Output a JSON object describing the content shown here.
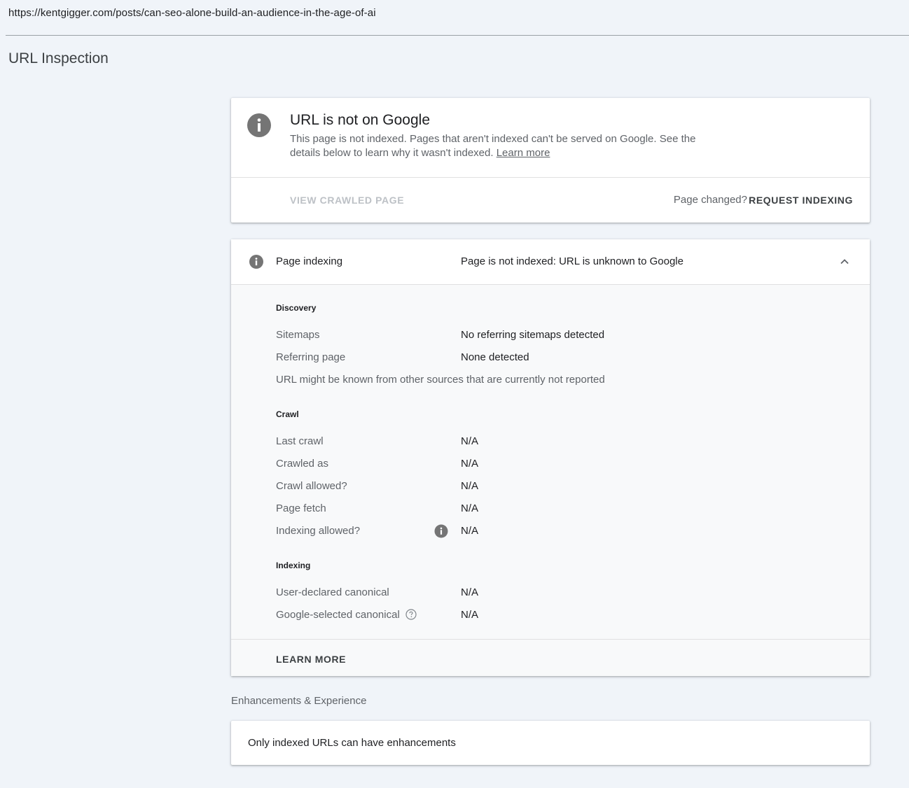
{
  "address_bar": {
    "url": "https://kentgigger.com/posts/can-seo-alone-build-an-audience-in-the-age-of-ai"
  },
  "page": {
    "title": "URL Inspection"
  },
  "status_card": {
    "icon": "info-icon",
    "title": "URL is not on Google",
    "description": "This page is not indexed. Pages that aren't indexed can't be served on Google. See the details below to learn why it wasn't indexed.",
    "learn_more_link": "Learn more",
    "view_crawled_label": "VIEW CRAWLED PAGE",
    "page_changed_text": "Page changed?",
    "request_indexing_label": "REQUEST INDEXING"
  },
  "page_indexing": {
    "icon": "info-icon",
    "label": "Page indexing",
    "status": "Page is not indexed: URL is unknown to Google",
    "expanded_icon": "chevron-up-icon",
    "discovery": {
      "heading": "Discovery",
      "rows": [
        {
          "label": "Sitemaps",
          "value": "No referring sitemaps detected"
        },
        {
          "label": "Referring page",
          "value": "None detected"
        }
      ],
      "note": "URL might be known from other sources that are currently not reported"
    },
    "crawl": {
      "heading": "Crawl",
      "rows": [
        {
          "label": "Last crawl",
          "value": "N/A"
        },
        {
          "label": "Crawled as",
          "value": "N/A"
        },
        {
          "label": "Crawl allowed?",
          "value": "N/A"
        },
        {
          "label": "Page fetch",
          "value": "N/A"
        },
        {
          "label": "Indexing allowed?",
          "value": "N/A"
        }
      ]
    },
    "indexing": {
      "heading": "Indexing",
      "rows": [
        {
          "label": "User-declared canonical",
          "value": "N/A"
        },
        {
          "label": "Google-selected canonical",
          "value": "N/A"
        }
      ]
    },
    "learn_more_label": "LEARN MORE"
  },
  "enhancements": {
    "heading": "Enhancements & Experience",
    "message": "Only indexed URLs can have enhancements"
  },
  "colors": {
    "background": "#f0f4f9",
    "card": "#ffffff",
    "card_body": "#f8f9fa",
    "info_icon": "#757575",
    "muted_text": "#5f6368",
    "disabled_text": "#bdc1c6"
  }
}
